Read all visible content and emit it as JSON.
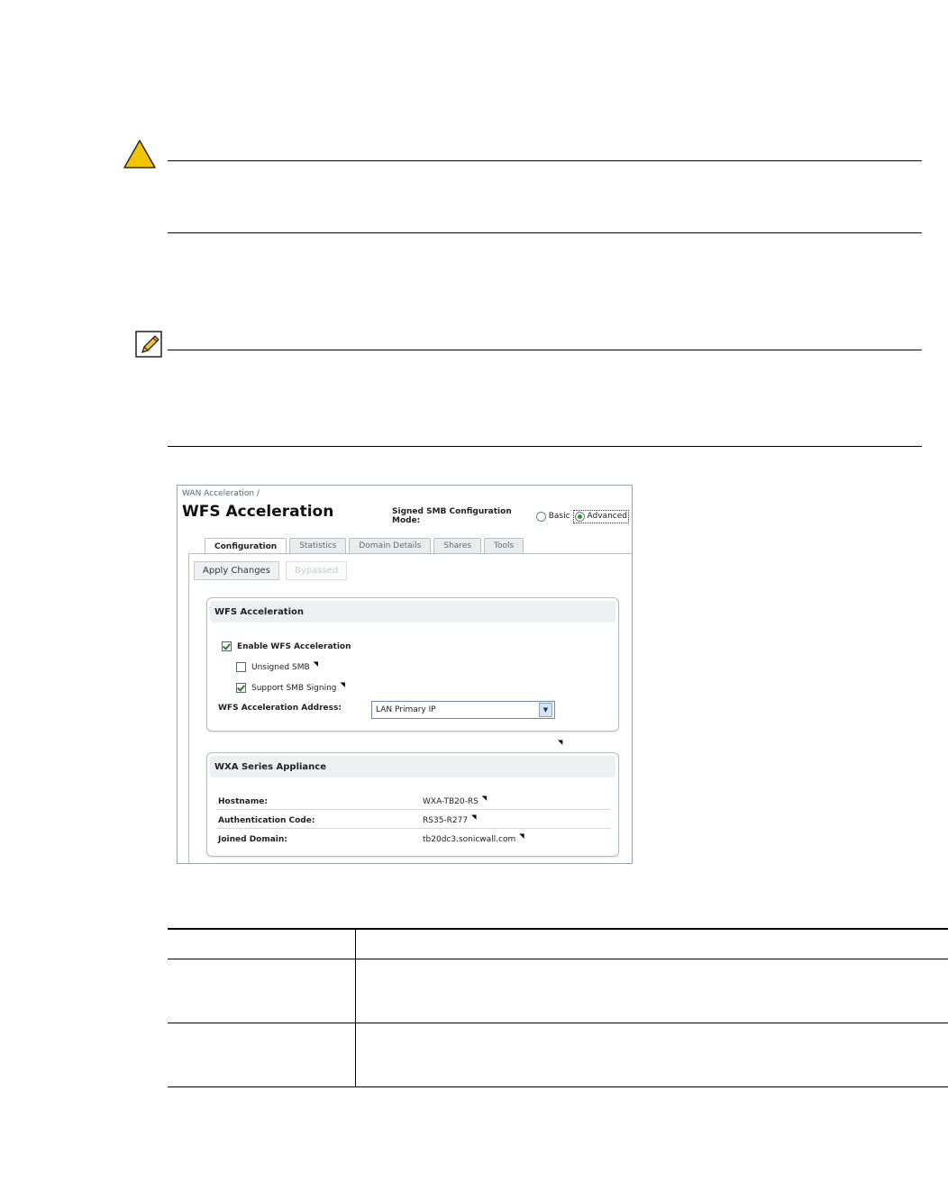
{
  "warning": {
    "icon": "warning-triangle-icon",
    "color": "#f5c400"
  },
  "note": {
    "icon": "pencil-note-icon"
  },
  "screenshot": {
    "breadcrumb": "WAN Acceleration /",
    "title": "WFS Acceleration",
    "mode": {
      "label": "Signed SMB Configuration Mode:",
      "options": [
        "Basic",
        "Advanced"
      ],
      "selected": "Advanced"
    },
    "tabs": [
      "Configuration",
      "Statistics",
      "Domain Details",
      "Shares",
      "Tools"
    ],
    "active_tab": "Configuration",
    "buttons": {
      "apply": "Apply Changes",
      "bypassed": "Bypassed"
    },
    "wfs_group": {
      "title": "WFS Acceleration",
      "enable_label": "Enable WFS Acceleration",
      "enable_checked": true,
      "unsigned_label": "Unsigned SMB",
      "unsigned_checked": false,
      "signing_label": "Support SMB Signing",
      "signing_checked": true,
      "address_label": "WFS Acceleration Address:",
      "address_value": "LAN Primary IP"
    },
    "wxa_group": {
      "title": "WXA Series Appliance",
      "rows": [
        {
          "label": "Hostname:",
          "value": "WXA-TB20-RS"
        },
        {
          "label": "Authentication Code:",
          "value": "RS35-R277"
        },
        {
          "label": "Joined Domain:",
          "value": "tb20dc3.sonicwall.com"
        }
      ]
    }
  }
}
